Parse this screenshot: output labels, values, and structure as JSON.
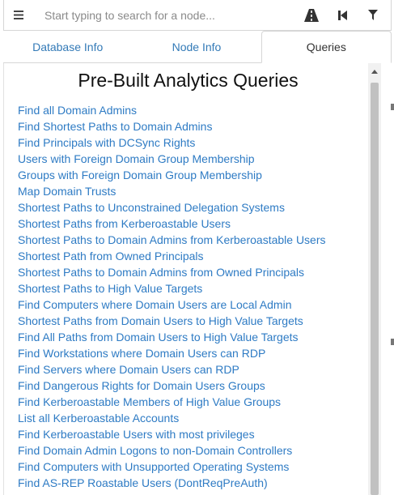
{
  "search": {
    "placeholder": "Start typing to search for a node...",
    "value": ""
  },
  "toolbar": {
    "menu_icon": "hamburger-menu-icon",
    "pathfinding_icon": "road-icon",
    "back_icon": "step-backward-icon",
    "filter_icon": "filter-icon"
  },
  "tabs": [
    {
      "label": "Database Info",
      "active": false
    },
    {
      "label": "Node Info",
      "active": false
    },
    {
      "label": "Queries",
      "active": true
    }
  ],
  "queries_panel": {
    "title": "Pre-Built Analytics Queries",
    "items": [
      "Find all Domain Admins",
      "Find Shortest Paths to Domain Admins",
      "Find Principals with DCSync Rights",
      "Users with Foreign Domain Group Membership",
      "Groups with Foreign Domain Group Membership",
      "Map Domain Trusts",
      "Shortest Paths to Unconstrained Delegation Systems",
      "Shortest Paths from Kerberoastable Users",
      "Shortest Paths to Domain Admins from Kerberoastable Users",
      "Shortest Path from Owned Principals",
      "Shortest Paths to Domain Admins from Owned Principals",
      "Shortest Paths to High Value Targets",
      "Find Computers where Domain Users are Local Admin",
      "Shortest Paths from Domain Users to High Value Targets",
      "Find All Paths from Domain Users to High Value Targets",
      "Find Workstations where Domain Users can RDP",
      "Find Servers where Domain Users can RDP",
      "Find Dangerous Rights for Domain Users Groups",
      "Find Kerberoastable Members of High Value Groups",
      "List all Kerberoastable Accounts",
      "Find Kerberoastable Users with most privileges",
      "Find Domain Admin Logons to non-Domain Controllers",
      "Find Computers with Unsupported Operating Systems",
      "Find AS-REP Roastable Users (DontReqPreAuth)"
    ]
  },
  "colors": {
    "link": "#2e7bc4",
    "tab_link": "#337ab7",
    "border": "#d6d6d6",
    "scroll_thumb": "#c1c1c1"
  }
}
